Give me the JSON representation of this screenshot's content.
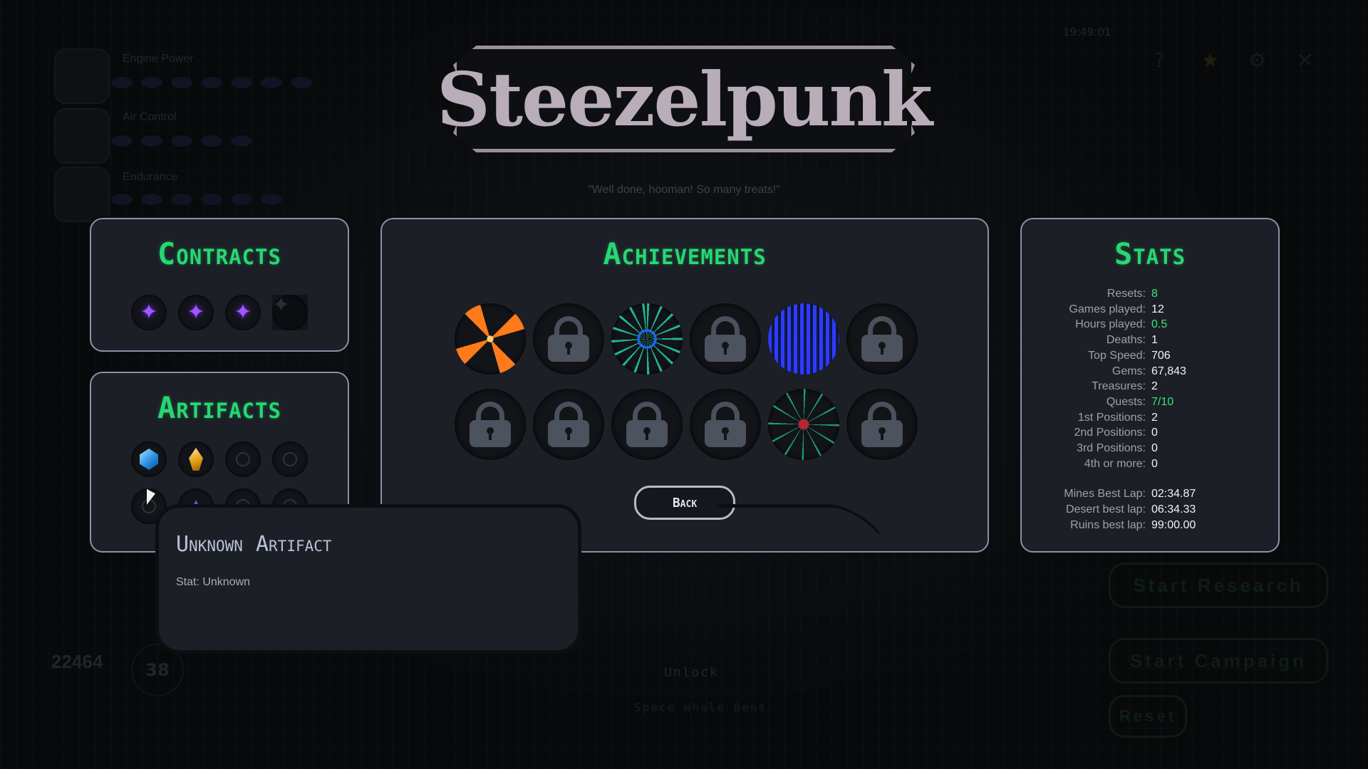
{
  "game": {
    "title": "Steezelpunk",
    "quote": "\"Well done, hooman! So many treats!\"",
    "clock": "19:49:01"
  },
  "background_ui": {
    "upgrades": [
      {
        "label": "Engine Power",
        "icon": "engine-icon"
      },
      {
        "label": "Air Control",
        "icon": "wing-icon"
      },
      {
        "label": "Endurance",
        "icon": "shield-wings-icon"
      }
    ],
    "currency": "22464",
    "level": "38",
    "buttons": {
      "start_research": "Start Research",
      "start_campaign": "Start Campaign",
      "reset": "Reset",
      "unlock": "Unlock",
      "saved_hint": "Space Whale Bent"
    }
  },
  "contracts": {
    "title": "Contracts",
    "items": [
      {
        "state": "complete",
        "icon": "purple-star-icon"
      },
      {
        "state": "complete",
        "icon": "purple-star-icon"
      },
      {
        "state": "complete",
        "icon": "purple-star-icon"
      },
      {
        "state": "empty",
        "icon": "empty-star-icon"
      }
    ]
  },
  "artifacts": {
    "title": "Artifacts",
    "items": [
      {
        "state": "found",
        "icon": "blue-gem-icon"
      },
      {
        "state": "found",
        "icon": "amber-gem-icon"
      },
      {
        "state": "empty",
        "icon": "empty-slot-icon"
      },
      {
        "state": "empty",
        "icon": "empty-slot-icon"
      },
      {
        "state": "hovered",
        "icon": "empty-slot-icon"
      },
      {
        "state": "found",
        "icon": "purple-gem-icon"
      },
      {
        "state": "empty",
        "icon": "empty-slot-icon"
      },
      {
        "state": "empty",
        "icon": "empty-slot-icon"
      }
    ]
  },
  "achievements": {
    "title": "Achievements",
    "items": [
      {
        "state": "unlocked",
        "icon": "orange-burst-icon"
      },
      {
        "state": "locked",
        "icon": "lock-icon"
      },
      {
        "state": "unlocked",
        "icon": "circuit-diamond-icon"
      },
      {
        "state": "locked",
        "icon": "lock-icon"
      },
      {
        "state": "unlocked",
        "icon": "blue-bars-icon"
      },
      {
        "state": "locked",
        "icon": "lock-icon"
      },
      {
        "state": "locked",
        "icon": "lock-icon"
      },
      {
        "state": "locked",
        "icon": "lock-icon"
      },
      {
        "state": "locked",
        "icon": "lock-icon"
      },
      {
        "state": "locked",
        "icon": "lock-icon"
      },
      {
        "state": "unlocked",
        "icon": "spider-icon"
      },
      {
        "state": "locked",
        "icon": "lock-icon"
      }
    ],
    "back_label": "Back"
  },
  "stats": {
    "title": "Stats",
    "rows": [
      {
        "label": "Resets:",
        "value": "8",
        "highlight": true
      },
      {
        "label": "Games played:",
        "value": "12",
        "highlight": false
      },
      {
        "label": "Hours played:",
        "value": "0.5",
        "highlight": true
      },
      {
        "label": "Deaths:",
        "value": "1",
        "highlight": false
      },
      {
        "label": "Top Speed:",
        "value": "706",
        "highlight": false
      },
      {
        "label": "Gems:",
        "value": "67,843",
        "highlight": false
      },
      {
        "label": "Treasures:",
        "value": "2",
        "highlight": false
      },
      {
        "label": "Quests:",
        "value": "7/10",
        "highlight": true
      },
      {
        "label": "1st Positions:",
        "value": "2",
        "highlight": false
      },
      {
        "label": "2nd Positions:",
        "value": "0",
        "highlight": false
      },
      {
        "label": "3rd Positions:",
        "value": "0",
        "highlight": false
      },
      {
        "label": "4th or more:",
        "value": "0",
        "highlight": false
      }
    ],
    "laps": [
      {
        "label": "Mines Best Lap:",
        "value": "02:34.87"
      },
      {
        "label": "Desert best lap:",
        "value": "06:34.33"
      },
      {
        "label": "Ruins best lap:",
        "value": "99:00.00"
      }
    ]
  },
  "tooltip": {
    "title": "Unknown Artifact",
    "stat": "Stat: Unknown"
  },
  "colors": {
    "accent_green": "#27d773",
    "panel_bg": "#1c1f26",
    "panel_border": "#8a92a8",
    "contract_purple": "#a057ff"
  }
}
